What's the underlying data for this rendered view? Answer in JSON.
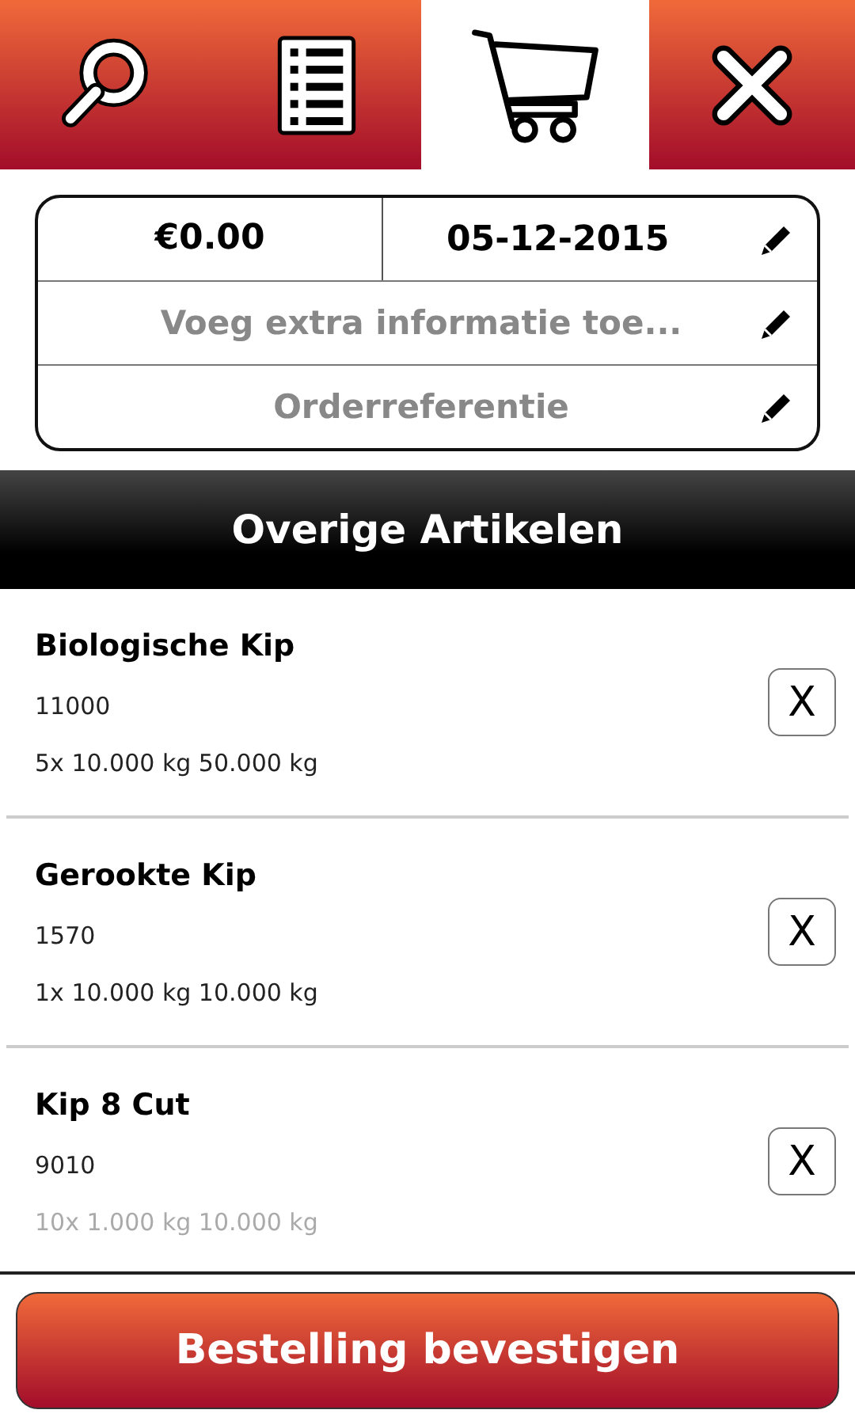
{
  "tabs": [
    {
      "kind": "search",
      "selected": false
    },
    {
      "kind": "list",
      "selected": false
    },
    {
      "kind": "cart",
      "selected": true
    },
    {
      "kind": "close",
      "selected": false
    }
  ],
  "order_info": {
    "amount": "€0.00",
    "date": "05-12-2015",
    "extra_info": {
      "placeholder": "Voeg extra informatie toe..."
    },
    "reference": {
      "placeholder": "Orderreferentie"
    }
  },
  "section_title": "Overige Artikelen",
  "items": [
    {
      "name": "Biologische Kip",
      "code": "11000",
      "quantity": "5x 10.000 kg 50.000 kg",
      "remove": "X"
    },
    {
      "name": "Gerookte Kip",
      "code": "1570",
      "quantity": "1x 10.000 kg 10.000 kg",
      "remove": "X"
    },
    {
      "name": "Kip 8 Cut",
      "code": "9010",
      "quantity": "10x 1.000 kg 10.000 kg",
      "remove": "X"
    }
  ],
  "confirm_button": "Bestelling bevestigen"
}
